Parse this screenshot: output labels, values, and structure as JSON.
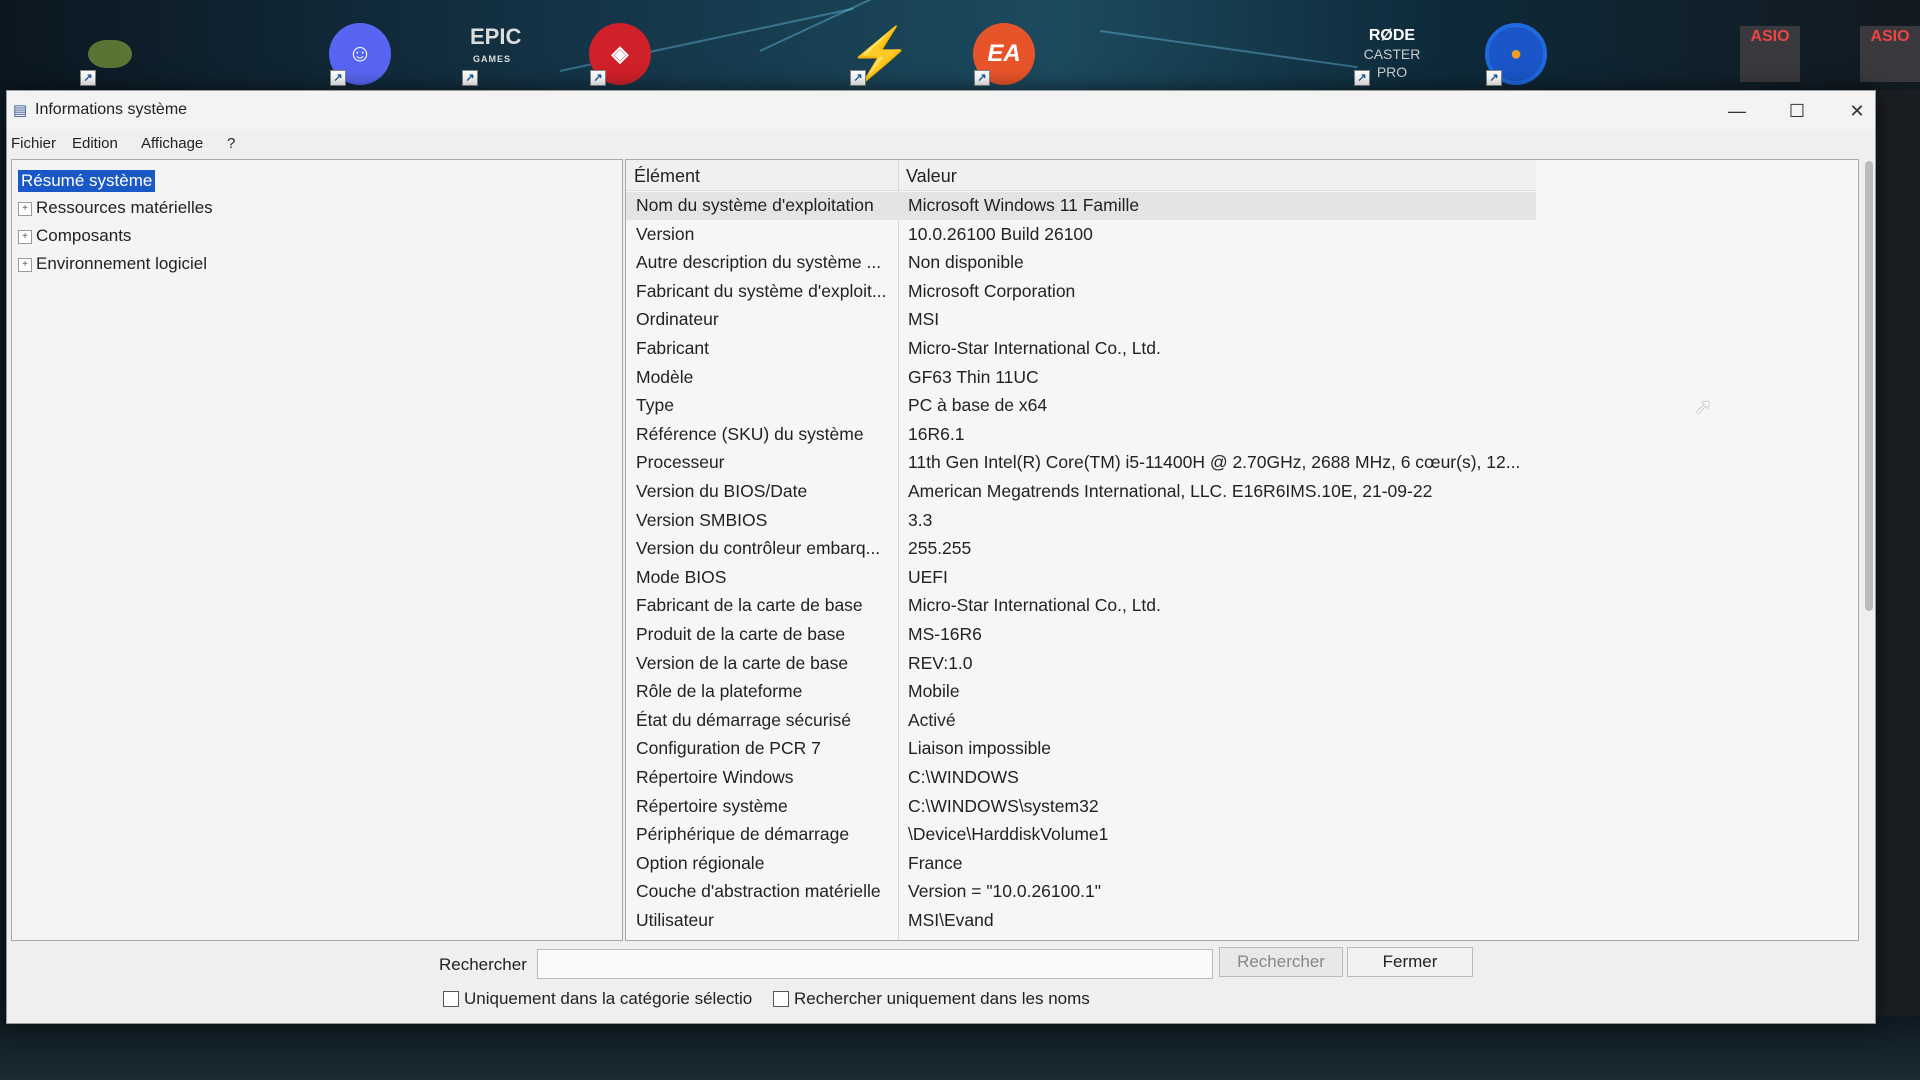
{
  "desktop": {
    "icons": [
      {
        "name": "nvidia",
        "glyph": ""
      },
      {
        "name": "discord",
        "glyph": "☺"
      },
      {
        "name": "epic",
        "glyph": "EPIC",
        "sub": "GAMES"
      },
      {
        "name": "msi",
        "glyph": "◈"
      },
      {
        "name": "bolt",
        "glyph": "⚡"
      },
      {
        "name": "ea",
        "glyph": "EA"
      },
      {
        "name": "rode",
        "glyph": "RØDE",
        "sub": "CASTER",
        "sub2": "PRO"
      },
      {
        "name": "headset",
        "glyph": "●"
      },
      {
        "name": "asio1",
        "glyph": "ASIO"
      },
      {
        "name": "asio2",
        "glyph": "ASIO"
      }
    ]
  },
  "window": {
    "title": "Informations système",
    "controls": {
      "minimize": "—",
      "maximize": "☐",
      "close": "✕"
    }
  },
  "menu": [
    "Fichier",
    "Edition",
    "Affichage",
    "?"
  ],
  "tree": {
    "selected": "Résumé système",
    "nodes": [
      "Ressources matérielles",
      "Composants",
      "Environnement logiciel"
    ],
    "expand_glyph": "+"
  },
  "list": {
    "headers": {
      "element": "Élément",
      "valeur": "Valeur"
    },
    "rows": [
      [
        "Nom du système d'exploitation",
        "Microsoft Windows 11 Famille"
      ],
      [
        "Version",
        "10.0.26100 Build 26100"
      ],
      [
        "Autre description du système ...",
        "Non disponible"
      ],
      [
        "Fabricant du système d'exploit...",
        "Microsoft Corporation"
      ],
      [
        "Ordinateur",
        "MSI"
      ],
      [
        "Fabricant",
        "Micro-Star International Co., Ltd."
      ],
      [
        "Modèle",
        "GF63 Thin 11UC"
      ],
      [
        "Type",
        "PC à base de x64"
      ],
      [
        "Référence (SKU) du système",
        "16R6.1"
      ],
      [
        "Processeur",
        "11th Gen Intel(R) Core(TM) i5-11400H @ 2.70GHz, 2688 MHz, 6 cœur(s), 12..."
      ],
      [
        "Version du BIOS/Date",
        "American Megatrends International, LLC. E16R6IMS.10E, 21-09-22"
      ],
      [
        "Version SMBIOS",
        "3.3"
      ],
      [
        "Version du contrôleur embarq...",
        "255.255"
      ],
      [
        "Mode BIOS",
        "UEFI"
      ],
      [
        "Fabricant de la carte de base",
        "Micro-Star International Co., Ltd."
      ],
      [
        "Produit de la carte de base",
        "MS-16R6"
      ],
      [
        "Version de la carte de base",
        "REV:1.0"
      ],
      [
        "Rôle de la plateforme",
        "Mobile"
      ],
      [
        "État du démarrage sécurisé",
        "Activé"
      ],
      [
        "Configuration de PCR 7",
        "Liaison impossible"
      ],
      [
        "Répertoire Windows",
        "C:\\WINDOWS"
      ],
      [
        "Répertoire système",
        "C:\\WINDOWS\\system32"
      ],
      [
        "Périphérique de démarrage",
        "\\Device\\HarddiskVolume1"
      ],
      [
        "Option régionale",
        "France"
      ],
      [
        "Couche d'abstraction matérielle",
        "Version = \"10.0.26100.1\""
      ],
      [
        "Utilisateur",
        "MSI\\Evand"
      ]
    ]
  },
  "search": {
    "label": "Rechercher",
    "value": "",
    "button": "Rechercher",
    "close": "Fermer",
    "checkbox_category": "Uniquement dans la catégorie sélectio",
    "checkbox_names": "Rechercher uniquement dans les noms"
  }
}
